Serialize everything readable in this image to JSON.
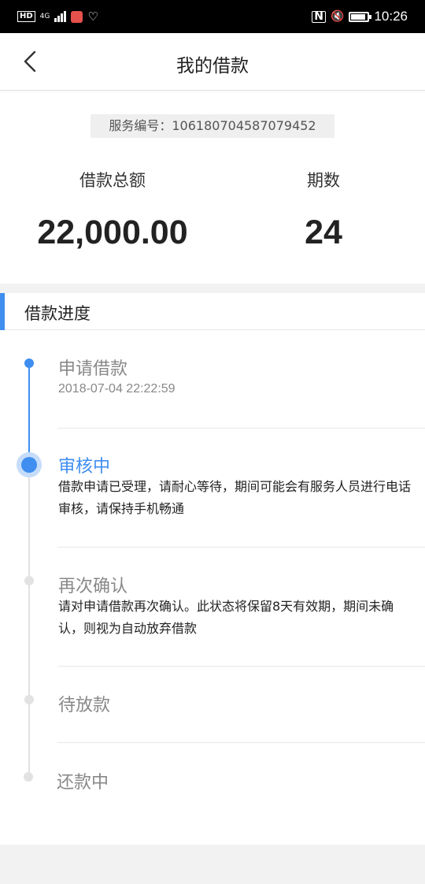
{
  "status_bar": {
    "left_icons": [
      "hd-icon",
      "4g-signal-icon",
      "app-notification-icon",
      "heart-icon"
    ],
    "network_label": "HD",
    "network_type": "4G",
    "nfc_label": "N",
    "time": "10:26"
  },
  "header": {
    "title": "我的借款",
    "back_icon": "chevron-left-icon"
  },
  "summary": {
    "service_no": "服务编号：106180704587079452",
    "amount_label": "借款总额",
    "amount_value": "22,000.00",
    "period_label": "期数",
    "period_value": "24"
  },
  "progress": {
    "title": "借款进度",
    "accent_color": "#3f8ef0",
    "steps": [
      {
        "title": "申请借款",
        "time": "2018-07-04 22:22:59",
        "status": "done"
      },
      {
        "title": "审核中",
        "desc": "借款申请已受理，请耐心等待，期间可能会有服务人员进行电话审核，请保持手机畅通",
        "status": "current"
      },
      {
        "title": "再次确认",
        "desc": "请对申请借款再次确认。此状态将保留8天有效期，期间未确认，则视为自动放弃借款",
        "status": "pending"
      },
      {
        "title": "待放款",
        "status": "pending"
      },
      {
        "title": "还款中",
        "status": "pending"
      }
    ]
  }
}
